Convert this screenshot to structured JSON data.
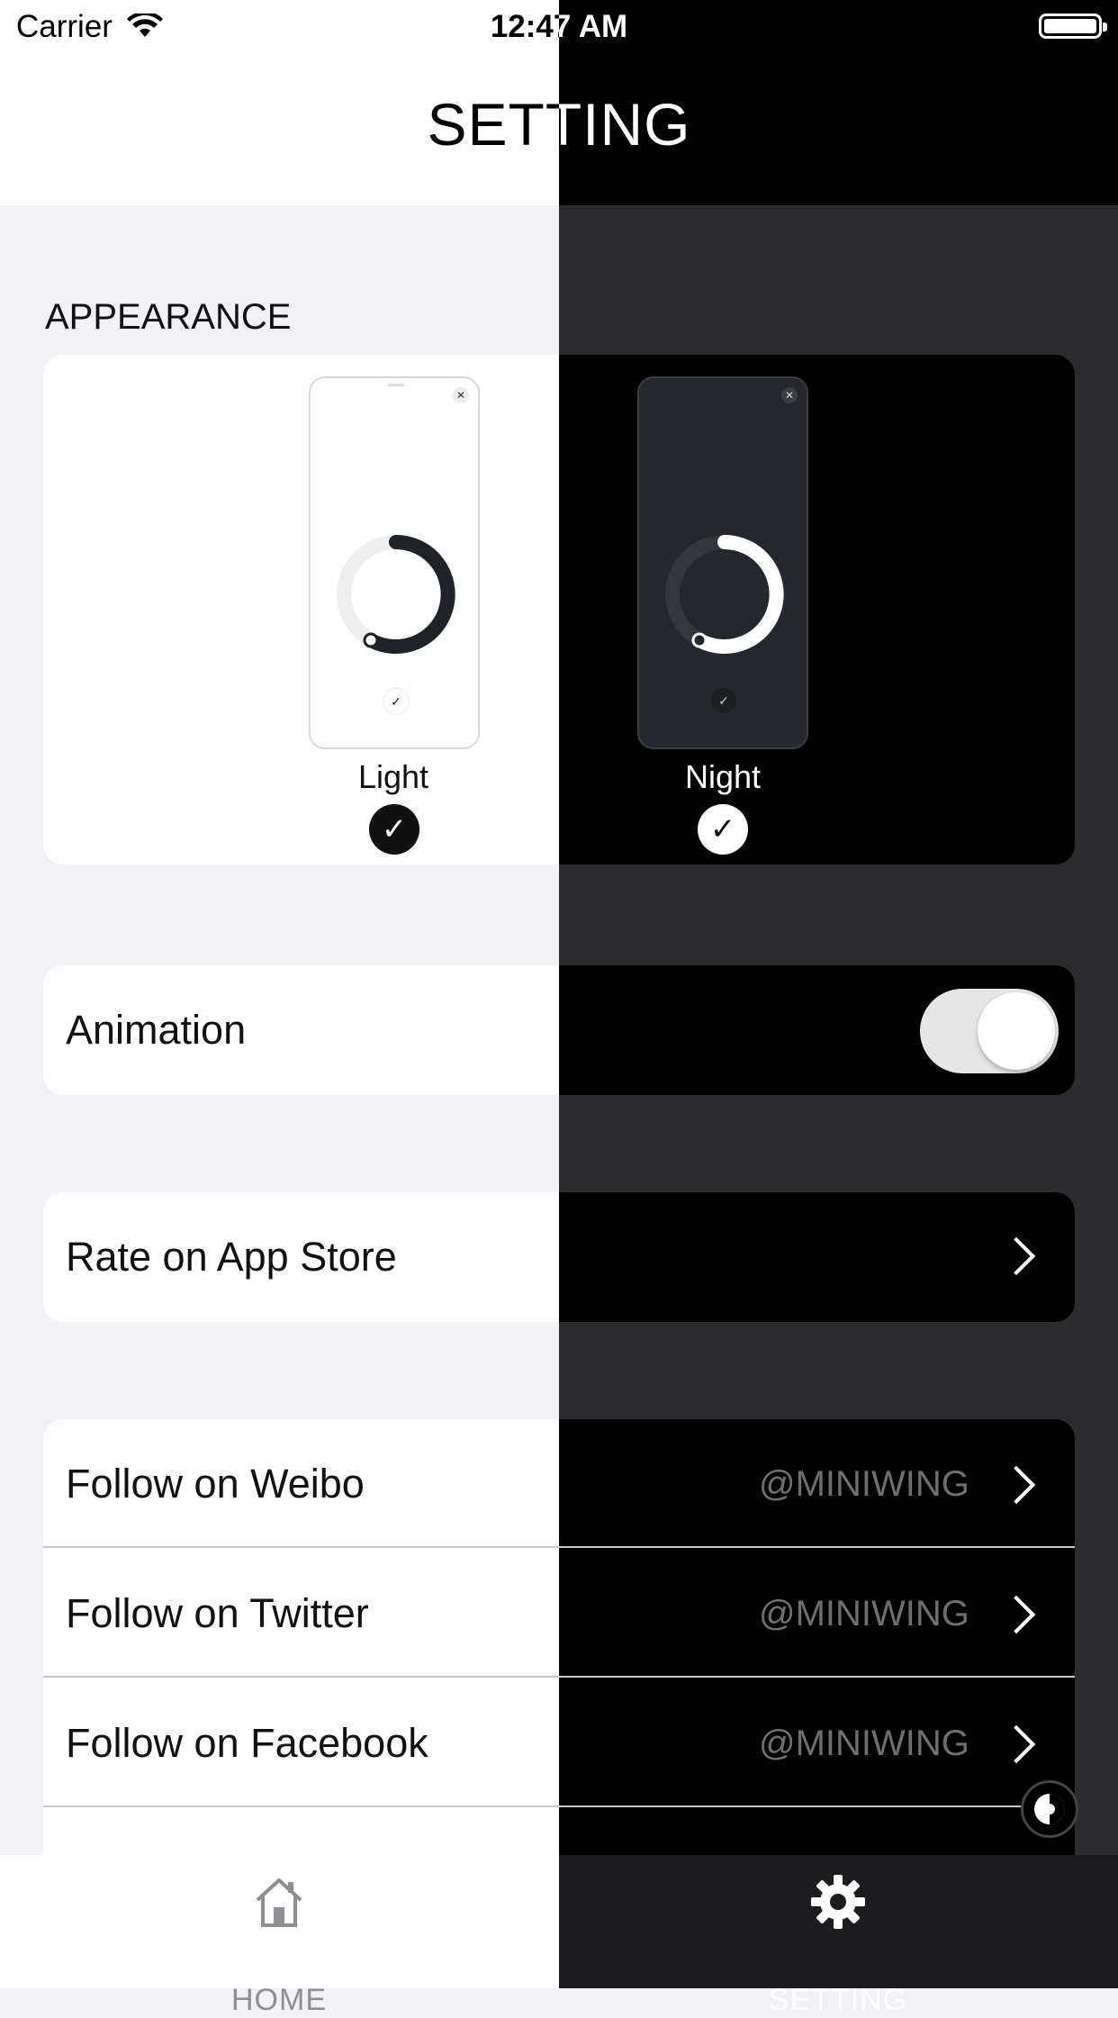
{
  "status_bar": {
    "carrier": "Carrier",
    "time": "12:47 AM"
  },
  "header": {
    "title": "SETTING"
  },
  "appearance": {
    "section_title": "APPEARANCE",
    "options": [
      {
        "label": "Light",
        "selected": true
      },
      {
        "label": "Night",
        "selected": true
      }
    ]
  },
  "animation": {
    "label": "Animation",
    "enabled": true
  },
  "rate": {
    "label": "Rate on App Store"
  },
  "follow": [
    {
      "label": "Follow on Weibo",
      "handle": "@MINIWING"
    },
    {
      "label": "Follow on Twitter",
      "handle": "@MINIWING"
    },
    {
      "label": "Follow on Facebook",
      "handle": "@MINIWING"
    }
  ],
  "tab_bar": {
    "items": [
      {
        "label": "HOME",
        "icon": "home-icon",
        "active": false
      },
      {
        "label": "SETTING",
        "icon": "gear-icon",
        "active": true
      }
    ]
  },
  "colors": {
    "light_bg": "#f2f2f6",
    "night_bg": "#2c2c2e",
    "card_light": "#ffffff",
    "card_night": "#000000",
    "handle_gray": "#6e6e73"
  }
}
